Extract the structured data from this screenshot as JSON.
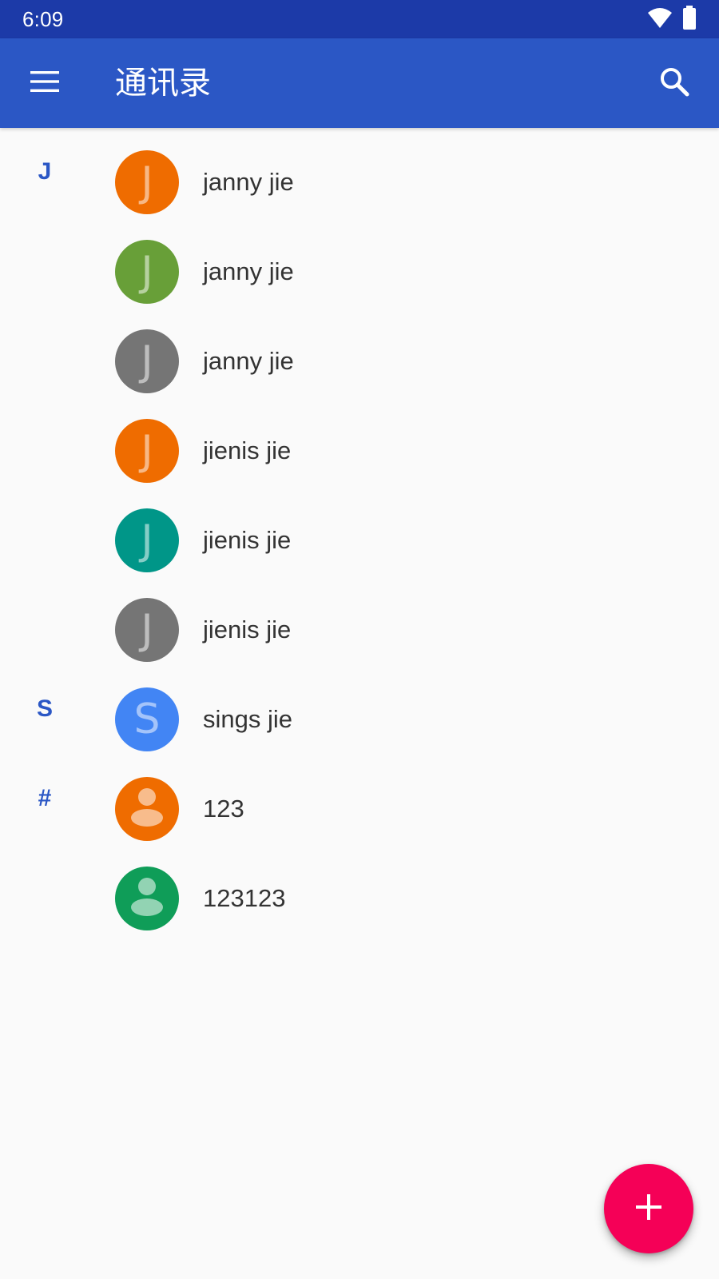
{
  "status_bar": {
    "time": "6:09",
    "icons": [
      "wifi-icon",
      "battery-icon"
    ],
    "background": "#1c3aa8"
  },
  "app_bar": {
    "title": "通讯录",
    "menu_icon": "menu-icon",
    "search_icon": "search-icon",
    "background": "#2b57c5"
  },
  "contacts": [
    {
      "section": "J",
      "name": "janny jie",
      "initial": "J",
      "color": "#ef6c00",
      "avatar": "letter"
    },
    {
      "section": "",
      "name": "janny jie",
      "initial": "J",
      "color": "#689f38",
      "avatar": "letter"
    },
    {
      "section": "",
      "name": "janny jie",
      "initial": "J",
      "color": "#757575",
      "avatar": "letter"
    },
    {
      "section": "",
      "name": "jienis jie",
      "initial": "J",
      "color": "#ef6c00",
      "avatar": "letter"
    },
    {
      "section": "",
      "name": "jienis jie",
      "initial": "J",
      "color": "#009688",
      "avatar": "letter"
    },
    {
      "section": "",
      "name": "jienis jie",
      "initial": "J",
      "color": "#757575",
      "avatar": "letter"
    },
    {
      "section": "S",
      "name": "sings jie",
      "initial": "S",
      "color": "#4285f4",
      "avatar": "letter"
    },
    {
      "section": "#",
      "name": "123",
      "initial": "",
      "color": "#ef6c00",
      "avatar": "person"
    },
    {
      "section": "",
      "name": "123123",
      "initial": "",
      "color": "#0f9d58",
      "avatar": "person"
    }
  ],
  "fab": {
    "icon": "add-icon",
    "color": "#f50057"
  },
  "colors": {
    "accent": "#2b57c5",
    "background": "#fafafa",
    "text": "#333333"
  }
}
